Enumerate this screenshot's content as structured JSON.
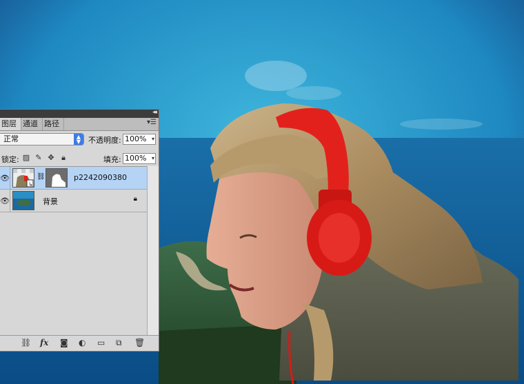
{
  "panel": {
    "tabs": [
      "图层",
      "通道",
      "路径"
    ],
    "active_tab": "图层",
    "blend_mode": "正常",
    "opacity_label": "不透明度:",
    "opacity_value": "100%",
    "lock_label": "锁定:",
    "fill_label": "填充:",
    "fill_value": "100%",
    "layers": [
      {
        "name": "p2242090380",
        "visible": true,
        "selected": true,
        "has_mask": true
      },
      {
        "name": "背景",
        "visible": true,
        "selected": false,
        "locked": true
      }
    ],
    "footer_icons": [
      "link-layers-icon",
      "fx-icon",
      "add-mask-icon",
      "adjustment-layer-icon",
      "new-group-icon",
      "new-layer-icon",
      "trash-icon"
    ],
    "fx_label": "fx"
  },
  "canvas": {
    "sky_color": "#2a8fc4",
    "sea_color": "#0d5a95",
    "headphone_color": "#e3211c"
  }
}
